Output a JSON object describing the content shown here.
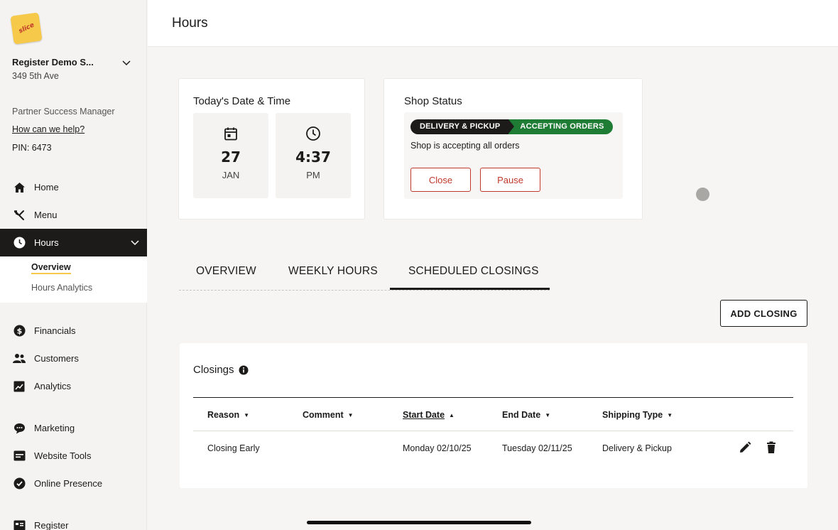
{
  "sidebar": {
    "logo_text": "slice",
    "shop_name": "Register Demo S...",
    "shop_address": "349 5th Ave",
    "psm_label": "Partner Success Manager",
    "help_link": "How can we help?",
    "pin": "PIN: 6473",
    "nav": {
      "home": "Home",
      "menu": "Menu",
      "hours": "Hours",
      "financials": "Financials",
      "customers": "Customers",
      "analytics": "Analytics",
      "marketing": "Marketing",
      "website_tools": "Website Tools",
      "online_presence": "Online Presence",
      "register": "Register"
    },
    "hours_submenu": {
      "overview": "Overview",
      "hours_analytics": "Hours Analytics"
    }
  },
  "header": {
    "title": "Hours"
  },
  "date_card": {
    "title": "Today's Date & Time",
    "day": "27",
    "month": "JAN",
    "time": "4:37",
    "meridiem": "PM"
  },
  "status_card": {
    "title": "Shop Status",
    "mode": "DELIVERY & PICKUP",
    "state": "ACCEPTING ORDERS",
    "message": "Shop is accepting all orders",
    "close_label": "Close",
    "pause_label": "Pause"
  },
  "tabs": {
    "overview": "OVERVIEW",
    "weekly_hours": "WEEKLY HOURS",
    "scheduled_closings": "SCHEDULED CLOSINGS"
  },
  "add_closing_label": "ADD CLOSING",
  "closings": {
    "title": "Closings",
    "columns": {
      "reason": "Reason",
      "comment": "Comment",
      "start_date": "Start Date",
      "end_date": "End Date",
      "shipping_type": "Shipping Type"
    },
    "rows": [
      {
        "reason": "Closing Early",
        "comment": "",
        "start_date": "Monday 02/10/25",
        "end_date": "Tuesday 02/11/25",
        "shipping_type": "Delivery & Pickup"
      }
    ]
  },
  "colors": {
    "accent_yellow": "#f6c94a",
    "danger_red": "#c0392b",
    "accepting_green": "#1e7c34",
    "dark": "#1c1b1a"
  }
}
